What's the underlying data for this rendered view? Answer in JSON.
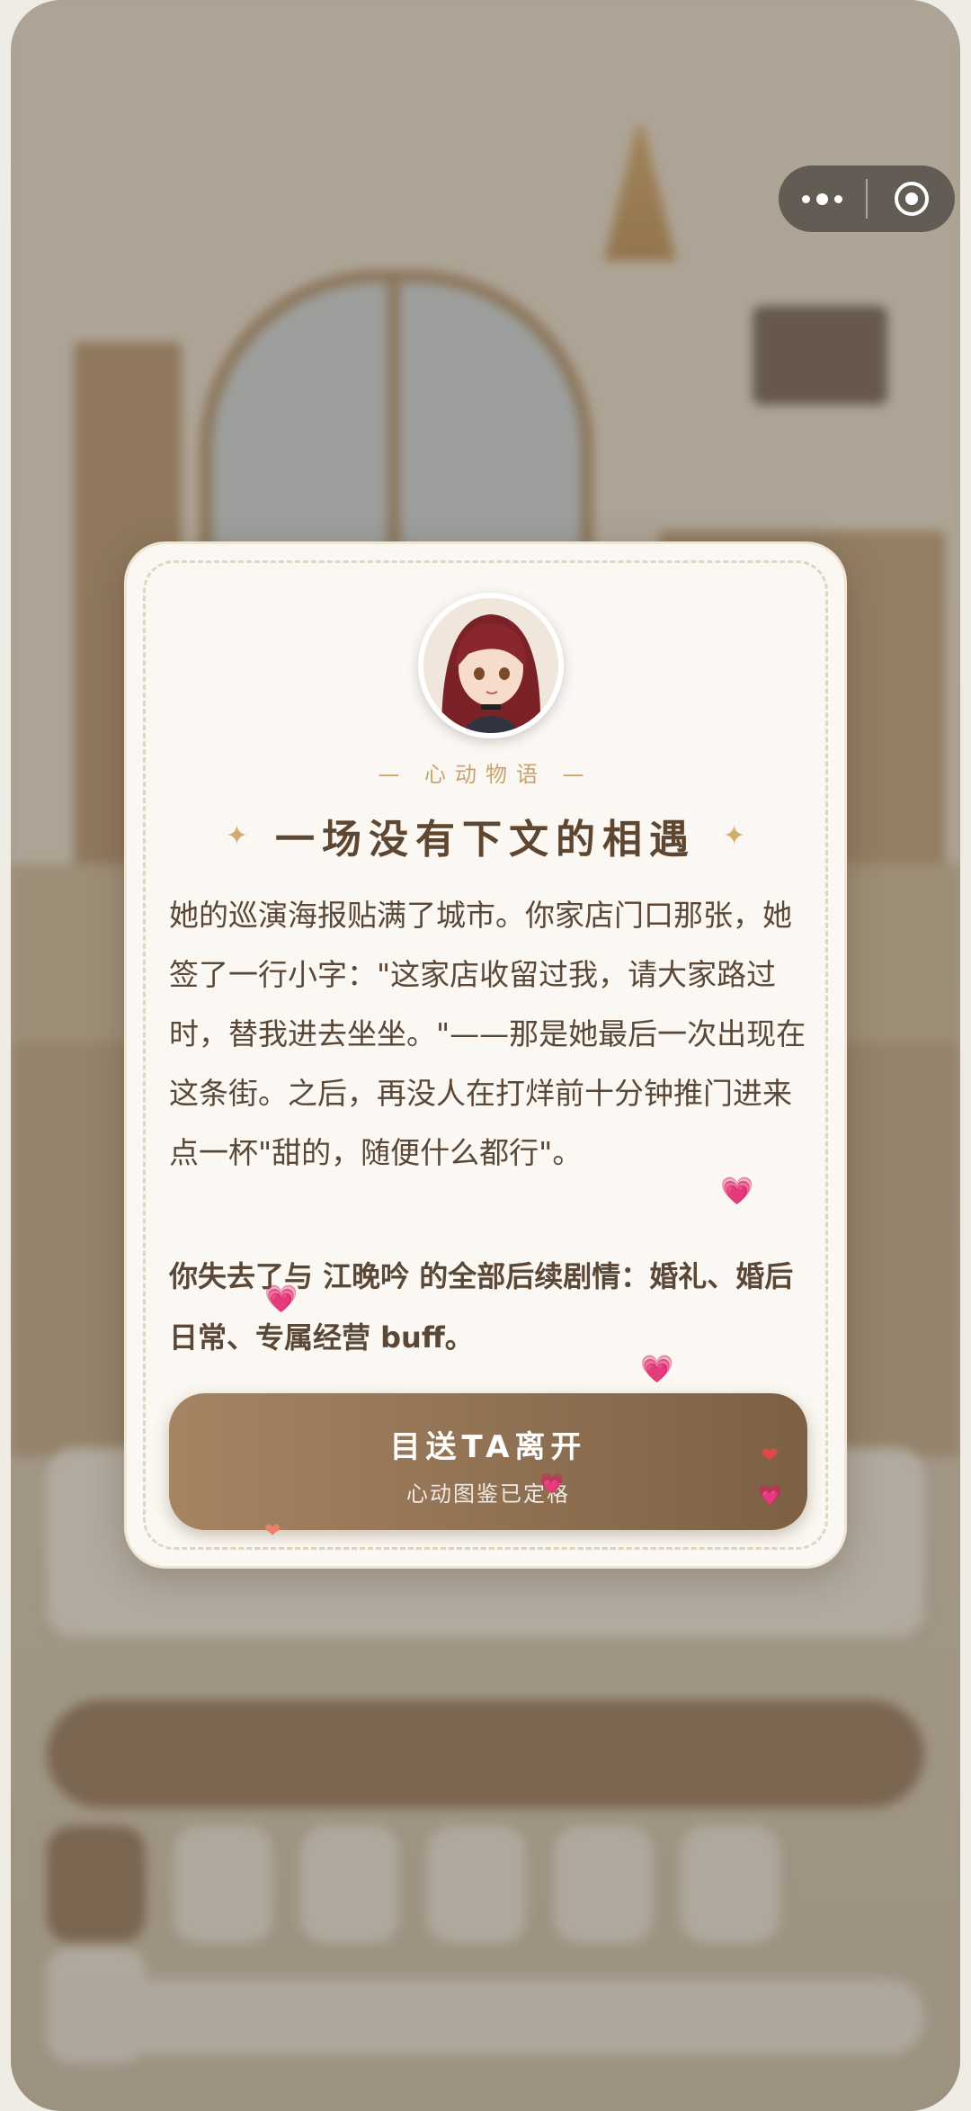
{
  "modal": {
    "section_label": "— 心动物语 —",
    "title": "一场没有下文的相遇",
    "story": "她的巡演海报贴满了城市。你家店门口那张，她签了一行小字：\"这家店收留过我，请大家路过时，替我进去坐坐。\"——那是她最后一次出现在这条街。之后，再没人在打烊前十分钟推门进来点一杯\"甜的，随便什么都行\"。",
    "loss_notice": "你失去了与 江晚吟 的全部后续剧情：婚礼、婚后日常、专属经营 buff。",
    "cta_label": "目送TA离开",
    "cta_sublabel": "心动图鉴已定格",
    "sparkle_glyph": "✦"
  },
  "capsule": {
    "more_icon": "more-dots-icon",
    "close_icon": "target-icon"
  },
  "colors": {
    "accent": "#c7a46f",
    "button_start": "#a58462",
    "button_end": "#7d6044",
    "title": "#5e4630"
  }
}
